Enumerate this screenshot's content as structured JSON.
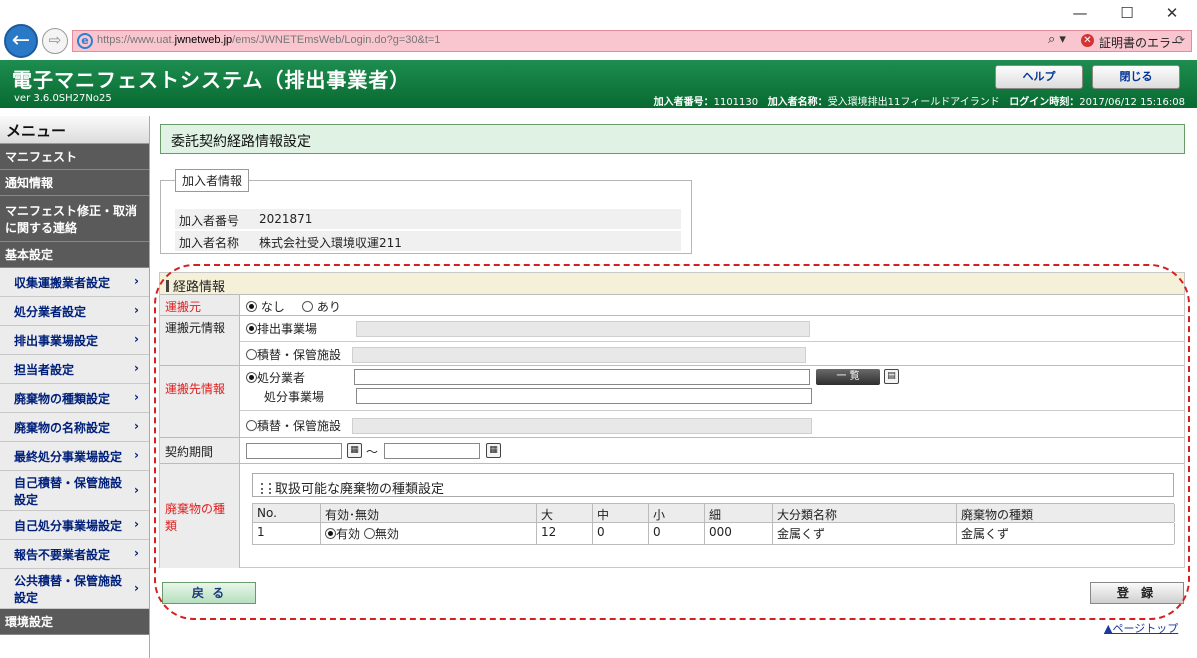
{
  "browser": {
    "url_host": "https://www.uat.",
    "url_domain": "jwnetweb.jp",
    "url_path": "/ems/JWNETEmsWeb/Login.do?g=30&t=1",
    "cert_error": "証明書のエラー",
    "minimize": "—",
    "maximize": "☐",
    "close": "✕",
    "back_glyph": "←",
    "forward_glyph": "⇨",
    "search_glyph": "⌕ ▾",
    "lock_glyph": "⟳"
  },
  "header": {
    "title": "電子マニフェストシステム（排出事業者）",
    "version": "ver 3.6.0SH27No25",
    "help_label": "ヘルプ",
    "close_label": "閉じる",
    "member_no_label": "加入者番号：",
    "member_no": "1101130",
    "member_name_label": "加入者名称：",
    "member_name": "受入環境排出11フィールドアイランド",
    "login_label": "ログイン時刻：",
    "login_time": "2017/06/12 15:16:08"
  },
  "sidebar": {
    "menu_title": "メニュー",
    "entries": [
      {
        "kind": "section",
        "label": "マニフェスト"
      },
      {
        "kind": "section",
        "label": "通知情報"
      },
      {
        "kind": "section",
        "label": "マニフェスト修正・取消に関する連絡"
      },
      {
        "kind": "section",
        "label": "基本設定"
      },
      {
        "kind": "item",
        "label": "収集運搬業者設定"
      },
      {
        "kind": "item",
        "label": "処分業者設定"
      },
      {
        "kind": "item",
        "label": "排出事業場設定"
      },
      {
        "kind": "item",
        "label": "担当者設定"
      },
      {
        "kind": "item",
        "label": "廃棄物の種類設定"
      },
      {
        "kind": "item",
        "label": "廃棄物の名称設定"
      },
      {
        "kind": "item",
        "label": "最終処分事業場設定"
      },
      {
        "kind": "item",
        "label": "自己積替・保管施設設定"
      },
      {
        "kind": "item",
        "label": "自己処分事業場設定"
      },
      {
        "kind": "item",
        "label": "報告不要業者設定"
      },
      {
        "kind": "item",
        "label": "公共積替・保管施設設定"
      },
      {
        "kind": "section",
        "label": "環境設定"
      }
    ],
    "chevron": "›"
  },
  "page": {
    "title": "委託契約経路情報設定",
    "subscriber": {
      "legend": "加入者情報",
      "no_label": "加入者番号",
      "no_value": "2021871",
      "name_label": "加入者名称",
      "name_value": "株式会社受入環境収運211"
    },
    "route": {
      "heading": "経路情報",
      "carrier_label": "運搬元",
      "carrier_opt_none": "なし",
      "carrier_opt_yes": "あり",
      "carrier_info_label": "運搬元情報",
      "opt_emission_site": "排出事業場",
      "opt_transfer_facility": "積替・保管施設",
      "dest_label": "運搬先情報",
      "opt_disposer": "処分業者",
      "disposal_site_label": "処分事業場",
      "list_button": "一 覧",
      "dest_transfer_facility": "積替・保管施設",
      "period_label": "契約期間",
      "period_sep": "〜",
      "waste_label": "廃棄物の種類",
      "calendar_glyph": "▦",
      "lookup_glyph": "▤"
    },
    "waste_table": {
      "title": "取扱可能な廃棄物の種類設定",
      "headers": [
        "No.",
        "有効･無効",
        "大",
        "中",
        "小",
        "細",
        "大分類名称",
        "廃棄物の種類"
      ],
      "rows": [
        {
          "no": "1",
          "enabled": "有効",
          "disabled": "無効",
          "large": "12",
          "mid": "0",
          "small": "0",
          "fine": "000",
          "category": "金属くず",
          "kind": "金属くず"
        }
      ]
    },
    "back_button": "戻 る",
    "register_button": "登 録",
    "page_top": "▲ページトップ"
  },
  "colors": {
    "header_green": "#086a31",
    "required_red": "#e02020",
    "highlight_dash": "#d42020"
  }
}
